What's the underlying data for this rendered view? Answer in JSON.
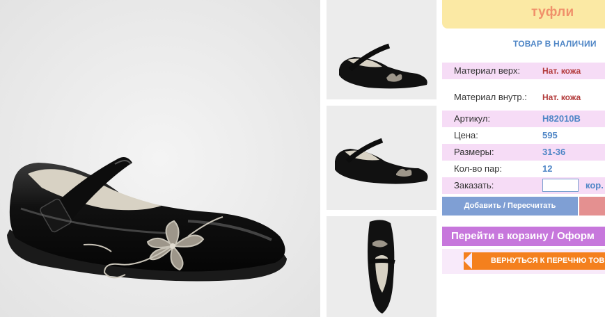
{
  "product": {
    "title": "туфли",
    "stock_status": "ТОВАР В НАЛИЧИИ"
  },
  "specs": [
    {
      "label": "Материал верх:",
      "value": "Нат. кожа"
    },
    {
      "label": "Материал внутр.:",
      "value": "Нат. кожа"
    },
    {
      "label": "Артикул:",
      "value": "H82010B"
    },
    {
      "label": "Цена:",
      "value": "595"
    },
    {
      "label": "Размеры:",
      "value": "31-36"
    },
    {
      "label": "Кол-во пар:",
      "value": "12"
    }
  ],
  "order": {
    "label": "Заказать:",
    "quantity_value": "",
    "unit": "кор."
  },
  "buttons": {
    "add": "Добавить / Пересчитать",
    "cart": "Перейти в корзину / Оформ",
    "back": "ВЕРНУТЬСЯ К ПЕРЕЧНЮ ТОВ"
  },
  "colors": {
    "accent_blue": "#4f86c6",
    "title_bg": "#fbe9a4",
    "title_text": "#f0906a",
    "row_pink": "#f6dcf6",
    "button_blue": "#7f9fd4",
    "button_purple": "#c777dc",
    "button_orange": "#f4801e"
  }
}
